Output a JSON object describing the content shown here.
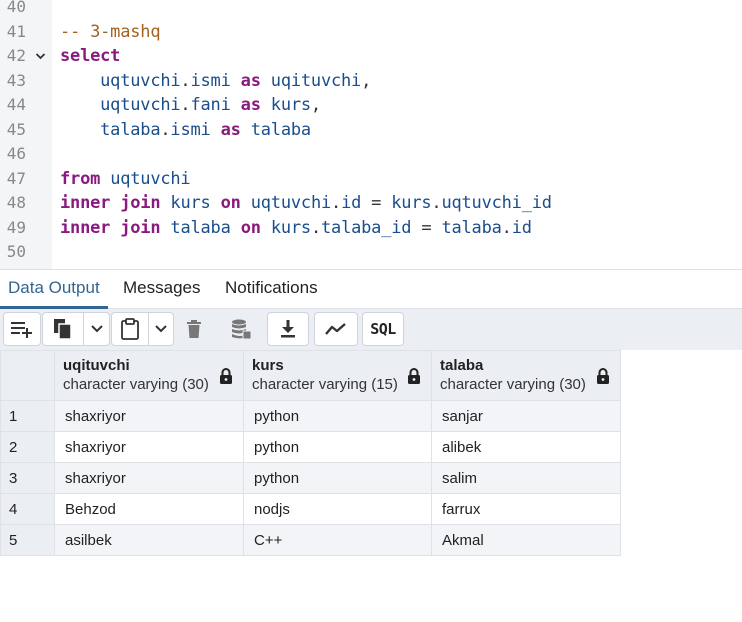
{
  "editor": {
    "lines": [
      {
        "n": "40",
        "fold": false,
        "tokens": []
      },
      {
        "n": "41",
        "fold": false,
        "tokens": [
          {
            "t": "-- 3-mashq",
            "k": "cm"
          }
        ]
      },
      {
        "n": "42",
        "fold": true,
        "tokens": [
          {
            "t": "select",
            "k": "kw"
          }
        ]
      },
      {
        "n": "43",
        "fold": false,
        "tokens": [
          {
            "t": "    ",
            "k": "sp"
          },
          {
            "t": "uqtuvchi",
            "k": "id"
          },
          {
            "t": ".",
            "k": "op"
          },
          {
            "t": "ismi",
            "k": "id"
          },
          {
            "t": " ",
            "k": "sp"
          },
          {
            "t": "as",
            "k": "kw"
          },
          {
            "t": " ",
            "k": "sp"
          },
          {
            "t": "uqituvchi",
            "k": "id"
          },
          {
            "t": ",",
            "k": "op"
          }
        ]
      },
      {
        "n": "44",
        "fold": false,
        "tokens": [
          {
            "t": "    ",
            "k": "sp"
          },
          {
            "t": "uqtuvchi",
            "k": "id"
          },
          {
            "t": ".",
            "k": "op"
          },
          {
            "t": "fani",
            "k": "id"
          },
          {
            "t": " ",
            "k": "sp"
          },
          {
            "t": "as",
            "k": "kw"
          },
          {
            "t": " ",
            "k": "sp"
          },
          {
            "t": "kurs",
            "k": "id"
          },
          {
            "t": ",",
            "k": "op"
          }
        ]
      },
      {
        "n": "45",
        "fold": false,
        "tokens": [
          {
            "t": "    ",
            "k": "sp"
          },
          {
            "t": "talaba",
            "k": "id"
          },
          {
            "t": ".",
            "k": "op"
          },
          {
            "t": "ismi",
            "k": "id"
          },
          {
            "t": " ",
            "k": "sp"
          },
          {
            "t": "as",
            "k": "kw"
          },
          {
            "t": " ",
            "k": "sp"
          },
          {
            "t": "talaba",
            "k": "id"
          }
        ]
      },
      {
        "n": "46",
        "fold": false,
        "tokens": []
      },
      {
        "n": "47",
        "fold": false,
        "tokens": [
          {
            "t": "from",
            "k": "kw"
          },
          {
            "t": " ",
            "k": "sp"
          },
          {
            "t": "uqtuvchi",
            "k": "id"
          }
        ]
      },
      {
        "n": "48",
        "fold": false,
        "tokens": [
          {
            "t": "inner",
            "k": "kw"
          },
          {
            "t": " ",
            "k": "sp"
          },
          {
            "t": "join",
            "k": "kw"
          },
          {
            "t": " ",
            "k": "sp"
          },
          {
            "t": "kurs",
            "k": "id"
          },
          {
            "t": " ",
            "k": "sp"
          },
          {
            "t": "on",
            "k": "kw"
          },
          {
            "t": " ",
            "k": "sp"
          },
          {
            "t": "uqtuvchi",
            "k": "id"
          },
          {
            "t": ".",
            "k": "op"
          },
          {
            "t": "id",
            "k": "id"
          },
          {
            "t": " = ",
            "k": "op"
          },
          {
            "t": "kurs",
            "k": "id"
          },
          {
            "t": ".",
            "k": "op"
          },
          {
            "t": "uqtuvchi_id",
            "k": "id"
          }
        ]
      },
      {
        "n": "49",
        "fold": false,
        "tokens": [
          {
            "t": "inner",
            "k": "kw"
          },
          {
            "t": " ",
            "k": "sp"
          },
          {
            "t": "join",
            "k": "kw"
          },
          {
            "t": " ",
            "k": "sp"
          },
          {
            "t": "talaba",
            "k": "id"
          },
          {
            "t": " ",
            "k": "sp"
          },
          {
            "t": "on",
            "k": "kw"
          },
          {
            "t": " ",
            "k": "sp"
          },
          {
            "t": "kurs",
            "k": "id"
          },
          {
            "t": ".",
            "k": "op"
          },
          {
            "t": "talaba_id",
            "k": "id"
          },
          {
            "t": " = ",
            "k": "op"
          },
          {
            "t": "talaba",
            "k": "id"
          },
          {
            "t": ".",
            "k": "op"
          },
          {
            "t": "id",
            "k": "id"
          }
        ]
      },
      {
        "n": "50",
        "fold": false,
        "tokens": []
      }
    ]
  },
  "tabs": [
    {
      "label": "Data Output",
      "active": true
    },
    {
      "label": "Messages",
      "active": false
    },
    {
      "label": "Notifications",
      "active": false
    }
  ],
  "toolbar": {
    "buttons": [
      "add-row-icon",
      "copy-icon",
      "chevron-down-icon",
      "paste-icon",
      "chevron-down-icon",
      "delete-icon",
      "save-data-icon",
      "download-icon",
      "graph-icon",
      "sql-icon"
    ],
    "sql_label": "SQL"
  },
  "grid": {
    "columns": [
      {
        "name": "uqituvchi",
        "type": "character varying (30)"
      },
      {
        "name": "kurs",
        "type": "character varying (15)"
      },
      {
        "name": "talaba",
        "type": "character varying (30)"
      }
    ],
    "rows": [
      {
        "n": "1",
        "cells": [
          "shaxriyor",
          "python",
          "sanjar"
        ]
      },
      {
        "n": "2",
        "cells": [
          "shaxriyor",
          "python",
          "alibek"
        ]
      },
      {
        "n": "3",
        "cells": [
          "shaxriyor",
          "python",
          "salim"
        ]
      },
      {
        "n": "4",
        "cells": [
          "Behzod",
          "nodjs",
          "farrux"
        ]
      },
      {
        "n": "5",
        "cells": [
          "asilbek",
          "C++",
          "Akmal"
        ]
      }
    ]
  },
  "colors": {
    "keyword": "#8a1a7f",
    "comment": "#a46222",
    "identifier": "#1a4d8c",
    "active_tab": "#326690"
  }
}
